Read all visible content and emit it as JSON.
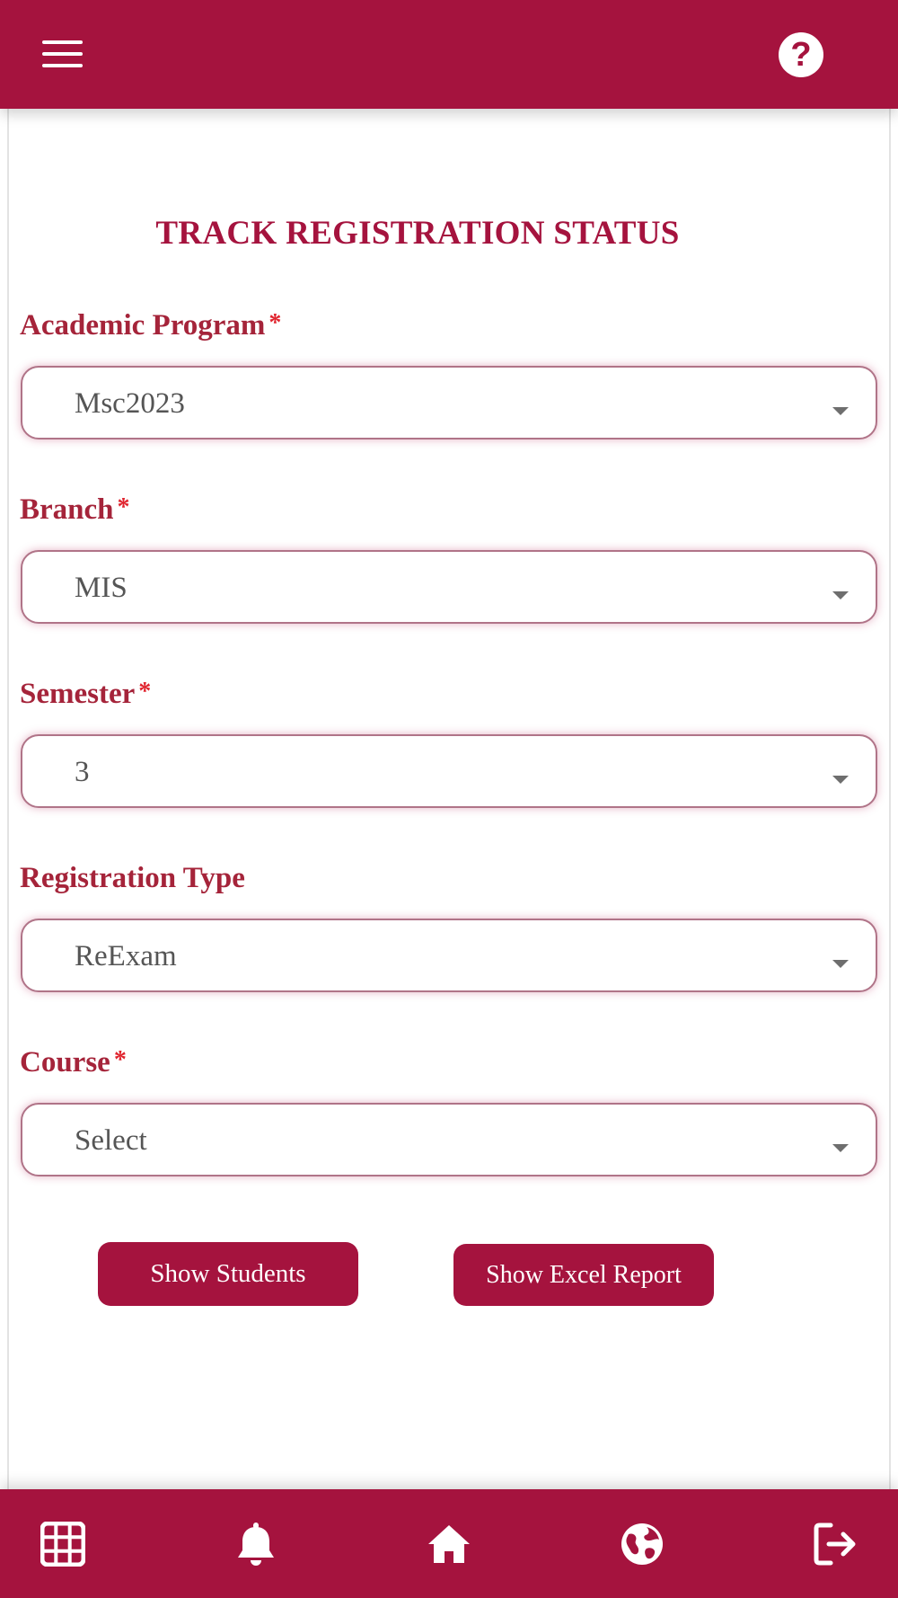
{
  "header": {
    "menu_icon": "hamburger-menu-icon",
    "help_icon": "help-question-icon",
    "help_glyph": "?"
  },
  "page": {
    "title": "TRACK REGISTRATION STATUS"
  },
  "form": {
    "required_marker": "*",
    "academic_program": {
      "label": "Academic Program",
      "value": "Msc2023",
      "required": true
    },
    "branch": {
      "label": "Branch",
      "value": "MIS",
      "required": true
    },
    "semester": {
      "label": "Semester",
      "value": "3",
      "required": true
    },
    "registration_type": {
      "label": "Registration Type",
      "value": "ReExam",
      "required": false
    },
    "course": {
      "label": "Course",
      "value": "Select",
      "required": true
    }
  },
  "actions": {
    "show_students": "Show Students",
    "show_excel_report": "Show Excel Report"
  },
  "bottom_nav": {
    "items": [
      "grid-icon",
      "bell-icon",
      "home-icon",
      "globe-icon",
      "logout-icon"
    ]
  },
  "colors": {
    "brand": "#a5133e",
    "label": "#a5243a",
    "required": "#e0242e"
  }
}
